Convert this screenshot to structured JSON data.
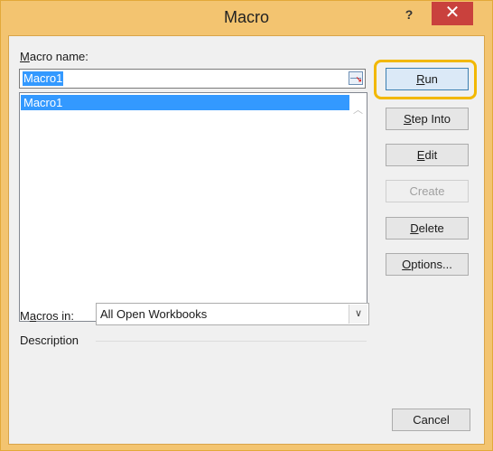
{
  "window": {
    "title": "Macro",
    "help_label": "?",
    "close_label": "✕"
  },
  "form": {
    "macro_name_label": "Macro name:",
    "macro_name_value": "Macro1",
    "picker_icon": "range-picker-icon",
    "macros_list": [
      "Macro1"
    ],
    "macros_in_label": "Macros in:",
    "macros_in_value": "All Open Workbooks",
    "description_label": "Description"
  },
  "buttons": {
    "run": "Run",
    "step_into": "Step Into",
    "edit": "Edit",
    "create": "Create",
    "delete": "Delete",
    "options": "Options...",
    "cancel": "Cancel"
  },
  "colors": {
    "highlight_outline": "#f2b800",
    "selection": "#3399ff",
    "close_button": "#c9413d"
  }
}
